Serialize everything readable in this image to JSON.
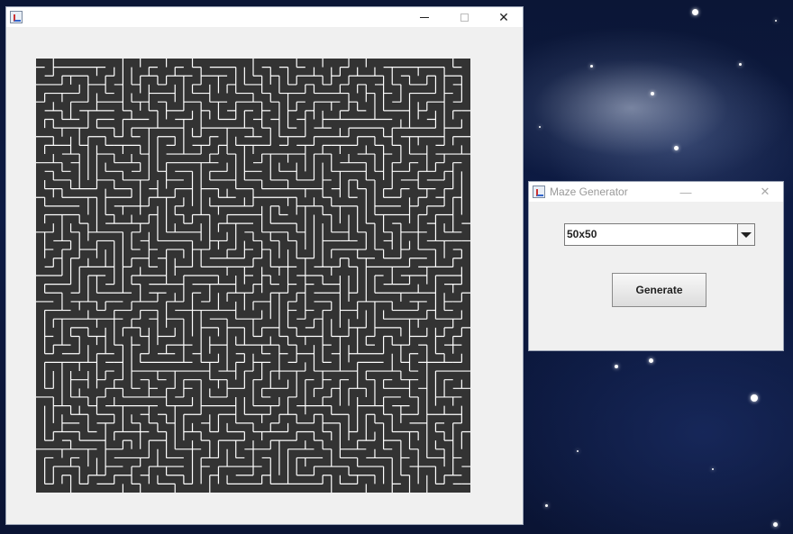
{
  "desktop": {
    "wallpaper": "starfield"
  },
  "maze_window": {
    "title": "",
    "icon": "java-app-icon",
    "controls": {
      "minimize": "minimize-icon",
      "maximize": "maximize-icon",
      "close": "close-icon"
    },
    "maze": {
      "grid_size": 50,
      "wall_color": "#ffffff",
      "background_color": "#333333"
    }
  },
  "generator_window": {
    "title": "Maze Generator",
    "icon": "java-app-icon",
    "size_select": {
      "value": "50x50"
    },
    "generate_label": "Generate"
  },
  "glyphs": {
    "minimize": "—",
    "close": "✕"
  }
}
